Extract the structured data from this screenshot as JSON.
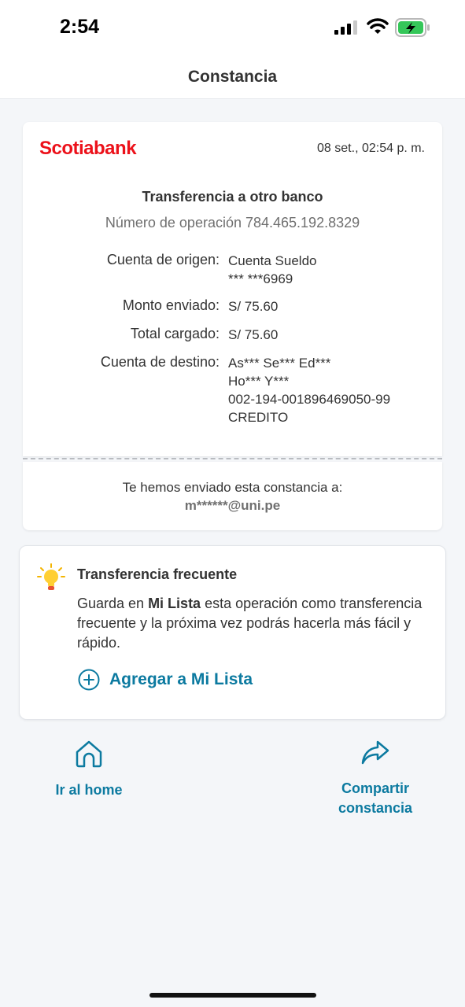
{
  "status_bar": {
    "time": "2:54"
  },
  "header": {
    "title": "Constancia"
  },
  "receipt": {
    "brand": "Scotiabank",
    "date": "08 set., 02:54 p. m.",
    "title": "Transferencia a otro banco",
    "operation": "Número de operación 784.465.192.8329",
    "rows": [
      {
        "label": "Cuenta de origen:",
        "lines": [
          "Cuenta Sueldo",
          "*** ***6969"
        ]
      },
      {
        "label": "Monto enviado:",
        "lines": [
          "S/ 75.60"
        ]
      },
      {
        "label": "Total cargado:",
        "lines": [
          "S/ 75.60"
        ]
      },
      {
        "label": "Cuenta de destino:",
        "lines": [
          "As*** Se*** Ed***",
          "Ho*** Y***",
          "002-194-001896469050-99",
          "CREDITO"
        ]
      }
    ]
  },
  "sent_to": {
    "label": "Te hemos enviado esta constancia a:",
    "email": "m******@uni.pe"
  },
  "tip": {
    "title": "Transferencia frecuente",
    "body_before": "Guarda en ",
    "body_bold": "Mi Lista",
    "body_after": " esta operación como transferencia frecuente y la próxima vez podrás hacerla más fácil y rápido.",
    "action_label": "Agregar a Mi Lista"
  },
  "actions": {
    "home_label": "Ir al home",
    "share_line1": "Compartir",
    "share_line2": "constancia"
  },
  "colors": {
    "brand_red": "#ec111a",
    "accent_blue": "#0c7aa0"
  },
  "icons": [
    "signal-icon",
    "wifi-icon",
    "battery-charging-icon",
    "lightbulb-icon",
    "plus-circle-icon",
    "home-icon",
    "share-icon"
  ]
}
